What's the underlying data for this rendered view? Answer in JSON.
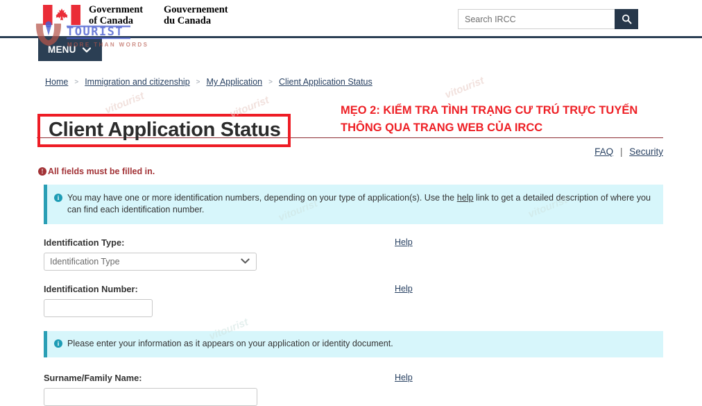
{
  "header": {
    "flag_alt": "Canada flag",
    "gov_en_line1": "Government",
    "gov_en_line2": "of Canada",
    "gov_fr_line1": "Gouvernement",
    "gov_fr_line2": "du Canada",
    "search_placeholder": "Search IRCC",
    "search_value": "",
    "search_button_icon": "search-icon",
    "accent_navy": "#26374a"
  },
  "menu": {
    "label": "MENU",
    "chevron_icon": "chevron-down-icon",
    "background": "#2b3f54"
  },
  "breadcrumb": {
    "items": [
      {
        "label": "Home"
      },
      {
        "label": "Immigration and citizenship"
      },
      {
        "label": "My Application"
      },
      {
        "label": "Client Application Status"
      }
    ],
    "separator": ">"
  },
  "page": {
    "title": "Client Application Status",
    "title_highlight_color": "#ee1c25",
    "rule_color": "#8c2d33"
  },
  "annotation": {
    "line1": "MẸO 2: KIỂM TRA TÌNH TRẠNG CƯ TRÚ TRỰC TUYẾN",
    "line2": "THÔNG QUA TRANG WEB CỦA IRCC",
    "color": "#ee2026"
  },
  "utility_links": {
    "faq": "FAQ",
    "divider": "|",
    "security": "Security"
  },
  "error": {
    "icon": "exclamation-circle-icon",
    "icon_glyph": "!",
    "message": "All fields must be filled in.",
    "color": "#a23236"
  },
  "alerts": [
    {
      "icon": "info-circle-icon",
      "icon_glyph": "i",
      "text_before_link": "You may have one or more identification numbers, depending on your type of application(s). Use the ",
      "link_text": "help",
      "text_after_link": " link to get a detailed description of where you can find each identification number.",
      "background": "#d7f6fb",
      "accent": "#2a9fb5"
    },
    {
      "icon": "info-circle-icon",
      "icon_glyph": "i",
      "text_before_link": "Please enter your information as it appears on your application or identity document.",
      "link_text": "",
      "text_after_link": "",
      "background": "#d7f6fb",
      "accent": "#2a9fb5"
    }
  ],
  "form": {
    "identification_type": {
      "label": "Identification Type:",
      "help_label": "Help",
      "selected_option": "Identification Type",
      "options": [
        "Identification Type"
      ],
      "chevron_icon": "chevron-down-icon"
    },
    "identification_number": {
      "label": "Identification Number:",
      "help_label": "Help",
      "value": "",
      "placeholder": ""
    },
    "surname": {
      "label": "Surname/Family Name:",
      "help_label": "Help",
      "value": "",
      "placeholder": ""
    }
  },
  "watermark": {
    "brand": "TOURIST",
    "brand_prefix": "V",
    "tagline": "MORE THAN WORDS",
    "diagonal_text": "vitourist"
  }
}
